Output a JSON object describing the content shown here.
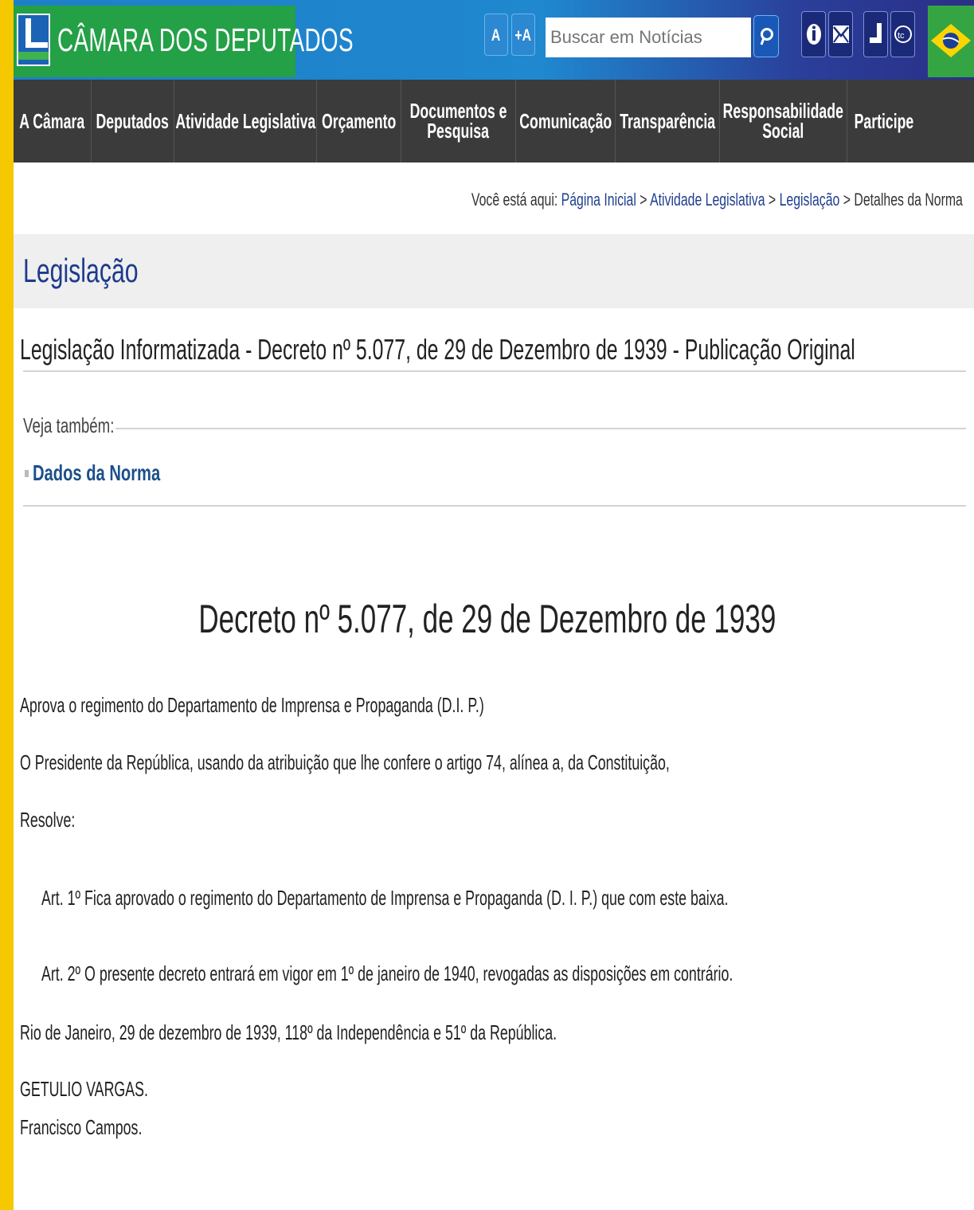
{
  "header": {
    "title": "CÂMARA DOS DEPUTADOS",
    "font_decrease_label": "A",
    "font_increase_label": "+A",
    "search_placeholder": "Buscar em Notícias",
    "icons": [
      "search-icon",
      "accessibility-icon",
      "mail-icon",
      "libras-icon",
      "tv-icon",
      "brazil-flag-icon"
    ]
  },
  "nav": {
    "items": [
      {
        "label": "A Câmara"
      },
      {
        "label": "Deputados"
      },
      {
        "label": "Atividade Legislativa"
      },
      {
        "label": "Orçamento"
      },
      {
        "label": "Documentos e",
        "label2": "Pesquisa"
      },
      {
        "label": "Comunicação"
      },
      {
        "label": "Transparência"
      },
      {
        "label": "Responsabilidade",
        "label2": "Social"
      },
      {
        "label": "Participe"
      }
    ]
  },
  "breadcrumb": {
    "prefix": "Você está aqui:",
    "items": [
      "Página Inicial",
      "Atividade Legislativa",
      "Legislação"
    ],
    "separator": ">",
    "current": "Detalhes da Norma"
  },
  "page": {
    "section_title": "Legislação",
    "heading": "Legislação Informatizada - Decreto nº 5.077, de 29 de Dezembro de 1939 - Publicação Original",
    "see_also_label": "Veja também:",
    "norma_link": "Dados da Norma"
  },
  "decree": {
    "title": "Decreto nº 5.077, de 29 de Dezembro de 1939",
    "ementa": "Aprova o regimento do Departamento de Imprensa e Propaganda (D.I. P.)",
    "preamble": "O Presidente da República, usando da atribuição que lhe confere o artigo 74, alínea a, da Constituição,",
    "resolve": "Resolve:",
    "art1": "Art. 1º Fica aprovado o regimento do Departamento de Imprensa e Propaganda (D. I. P.) que com este baixa.",
    "art2": "Art. 2º O presente decreto entrará em vigor em 1º de janeiro de 1940, revogadas as disposições em contrário.",
    "place_date": "Rio de Janeiro, 29 de dezembro de 1939, 118º da Independência e 51º da República.",
    "signature1": "GETULIO VARGAS.",
    "signature2": "Francisco Campos."
  },
  "colors": {
    "accent_yellow": "#f5c800",
    "brand_green": "#24a047",
    "header_blue": "#1e7fc8",
    "nav_dark": "#3b3b3b",
    "link_blue": "#1b4f8a"
  }
}
